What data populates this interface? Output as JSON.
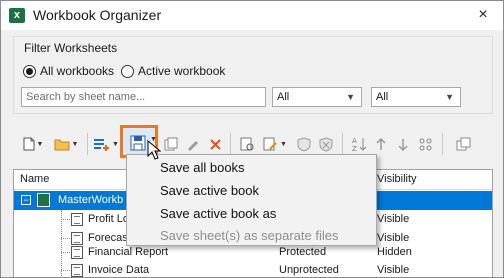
{
  "window": {
    "title": "Workbook Organizer",
    "app_icon_text": "X",
    "close_glyph": "×"
  },
  "filter": {
    "group_title": "Filter Worksheets",
    "radios": [
      {
        "label": "All workbooks",
        "checked": true
      },
      {
        "label": "Active workbook",
        "checked": false
      }
    ],
    "search": {
      "value": "",
      "placeholder": "Search by sheet name..."
    },
    "select_1": {
      "value": "All"
    },
    "select_2": {
      "value": "All"
    }
  },
  "toolbar": {
    "buttons": [
      {
        "icon": "new-document-icon"
      },
      {
        "icon": "open-folder-icon"
      },
      {
        "icon": "insert-icon"
      },
      {
        "icon": "save-icon",
        "highlighted": true
      },
      {
        "icon": "copy-icon"
      },
      {
        "icon": "rename-icon"
      },
      {
        "icon": "delete-icon"
      },
      {
        "icon": "preview-icon"
      },
      {
        "icon": "format-icon"
      },
      {
        "icon": "protect-icon"
      },
      {
        "icon": "unprotect-icon"
      },
      {
        "icon": "sort-az-icon"
      },
      {
        "icon": "move-up-icon"
      },
      {
        "icon": "move-down-icon"
      },
      {
        "icon": "group-icon"
      },
      {
        "icon": "window-icon"
      }
    ],
    "highlight_color": "#f07622"
  },
  "tree": {
    "columns": {
      "name": "Name",
      "visibility": "Visibility"
    },
    "rows": [
      {
        "name": "MasterWorkb",
        "protection": "",
        "visibility": "",
        "selected": true,
        "expander": "−"
      },
      {
        "name": "Profit Los",
        "protection": "",
        "visibility": "Visible"
      },
      {
        "name": "Forecast F",
        "protection": "",
        "visibility": "Visible"
      },
      {
        "name": "Financial Report",
        "protection": "Protected",
        "visibility": "Hidden"
      },
      {
        "name": "Invoice Data",
        "protection": "Unprotected",
        "visibility": "Visible"
      }
    ],
    "selection_color": "#0078d7"
  },
  "menu": {
    "items": [
      {
        "label": "Save all books",
        "enabled": true
      },
      {
        "label": "Save active book",
        "enabled": true
      },
      {
        "label": "Save active book as",
        "enabled": true
      },
      {
        "label": "Save sheet(s) as separate files",
        "enabled": false
      }
    ]
  }
}
